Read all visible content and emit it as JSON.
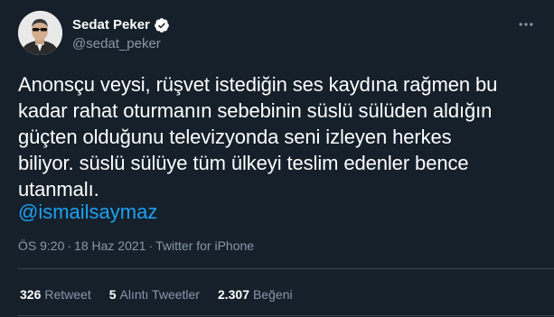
{
  "author": {
    "name": "Sedat Peker",
    "handle": "@sedat_peker",
    "verified": true,
    "avatar_icon": "profile-photo"
  },
  "more_icon": "ellipsis-icon",
  "tweet": {
    "text": "Anonsçu veysi, rüşvet istediğin ses kaydına rağmen bu\nkadar rahat oturmanın sebebinin süslü sülüden aldığın\ngüçten olduğunu televizyonda seni izleyen herkes\nbiliyor. süslü sülüye tüm ülkeyi teslim edenler bence\nutanmalı.",
    "mention": "@ismailsaymaz"
  },
  "meta": {
    "time": "ÖS 9:20",
    "separator": "·",
    "date": "18 Haz 2021",
    "source": "Twitter for iPhone"
  },
  "stats": {
    "retweets_count": "326",
    "retweets_label": "Retweet",
    "quotes_count": "5",
    "quotes_label": "Alıntı Tweetler",
    "likes_count": "2.307",
    "likes_label": "Beğeni"
  },
  "colors": {
    "background": "#15202b",
    "text": "#ffffff",
    "secondary": "#8899a6",
    "link": "#1da1f2",
    "divider": "#38444d"
  }
}
